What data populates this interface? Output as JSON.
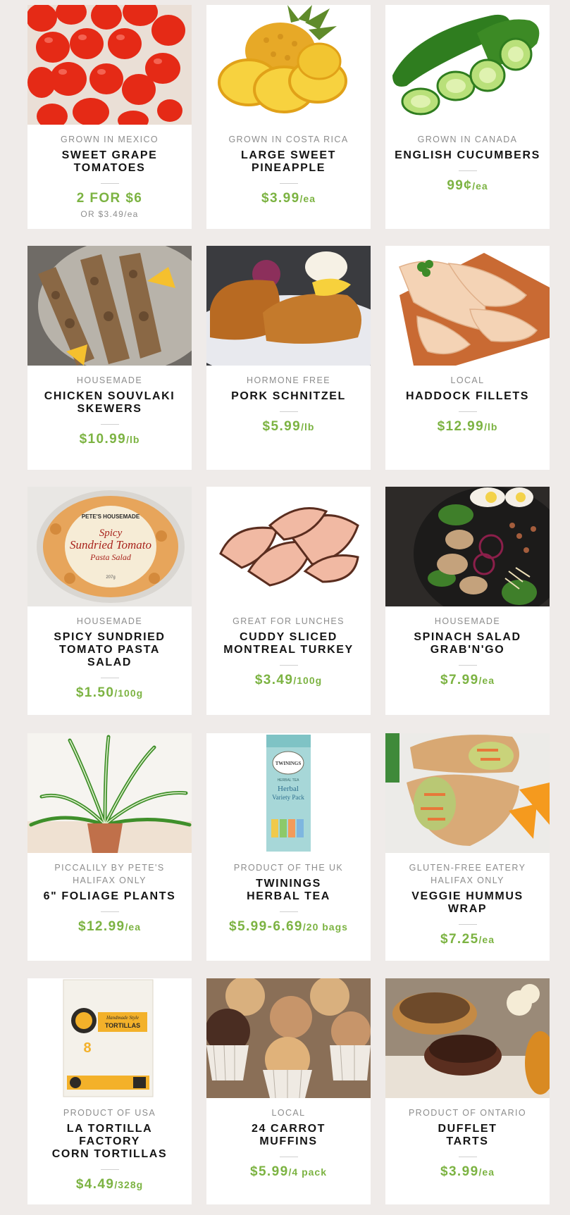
{
  "products": [
    {
      "origin_lines": [
        "Grown in Mexico"
      ],
      "name": "SWEET GRAPE\nTOMATOES",
      "price": "2 FOR $6",
      "unit": "",
      "sub": "OR $3.49/ea",
      "image": "grape-tomatoes-image",
      "image_alt": "Red grape tomatoes"
    },
    {
      "origin_lines": [
        "Grown in Costa Rica"
      ],
      "name": "LARGE SWEET\nPINEAPPLE",
      "price": "$3.99",
      "unit": "/ea",
      "sub": "",
      "image": "pineapple-image",
      "image_alt": "Sliced pineapple"
    },
    {
      "origin_lines": [
        "Grown in Canada"
      ],
      "name": "ENGLISH CUCUMBERS",
      "price": "99¢",
      "unit": "/ea",
      "sub": "",
      "image": "cucumber-image",
      "image_alt": "Sliced cucumber"
    },
    {
      "origin_lines": [
        "Housemade"
      ],
      "name": "CHICKEN SOUVLAKI\nSKEWERS",
      "price": "$10.99",
      "unit": "/lb",
      "sub": "",
      "image": "souvlaki-image",
      "image_alt": "Chicken souvlaki skewers"
    },
    {
      "origin_lines": [
        "Hormone Free"
      ],
      "name": "PORK SCHNITZEL",
      "price": "$5.99",
      "unit": "/lb",
      "sub": "",
      "image": "schnitzel-image",
      "image_alt": "Pork schnitzel"
    },
    {
      "origin_lines": [
        "Local"
      ],
      "name": "HADDOCK FILLETS",
      "price": "$12.99",
      "unit": "/lb",
      "sub": "",
      "image": "haddock-image",
      "image_alt": "Haddock fillets on board"
    },
    {
      "origin_lines": [
        "Housemade"
      ],
      "name": "SPICY SUNDRIED\nTOMATO PASTA\nSALAD",
      "price": "$1.50",
      "unit": "/100g",
      "sub": "",
      "image": "pasta-salad-image",
      "image_alt": "Pasta salad container",
      "label_text": {
        "brand": "PETE'S HOUSEMADE",
        "line1": "Spicy",
        "line2": "Sundried Tomato",
        "line3": "Pasta Salad",
        "weight": "207g"
      }
    },
    {
      "origin_lines": [
        "Great for Lunches"
      ],
      "name": "CUDDY SLICED\nMONTREAL TURKEY",
      "price": "$3.49",
      "unit": "/100g",
      "sub": "",
      "image": "turkey-image",
      "image_alt": "Sliced turkey"
    },
    {
      "origin_lines": [
        "Housemade"
      ],
      "name": "SPINACH SALAD\nGRAB'N'GO",
      "price": "$7.99",
      "unit": "/ea",
      "sub": "",
      "image": "spinach-salad-image",
      "image_alt": "Spinach salad"
    },
    {
      "origin_lines": [
        "Piccalily by Pete's",
        "Halifax Only"
      ],
      "name": "6\" FOLIAGE PLANTS",
      "price": "$12.99",
      "unit": "/ea",
      "sub": "",
      "image": "plant-image",
      "image_alt": "Spider plant"
    },
    {
      "origin_lines": [
        "Product of the UK"
      ],
      "name": "TWININGS\nHERBAL TEA",
      "price": "$5.99-6.69",
      "unit": "/20 bags",
      "sub": "",
      "image": "tea-box-image",
      "image_alt": "Twinings tea box",
      "label_text": {
        "brand": "TWININGS",
        "line1": "HERBAL TEA",
        "line2": "Herbal",
        "line3": "Variety Pack"
      }
    },
    {
      "origin_lines": [
        "Gluten-Free Eatery",
        "Halifax Only"
      ],
      "name": "VEGGIE HUMMUS\nWRAP",
      "price": "$7.25",
      "unit": "/ea",
      "sub": "",
      "image": "wrap-image",
      "image_alt": "Veggie wrap"
    },
    {
      "origin_lines": [
        "Product of USA"
      ],
      "name": "LA TORTILLA\nFACTORY\nCORN TORTILLAS",
      "price": "$4.49",
      "unit": "/328g",
      "sub": "",
      "image": "tortillas-image",
      "image_alt": "Tortilla package",
      "label_text": {
        "line1": "Handmade Style",
        "line2": "TORTILLAS",
        "count": "8"
      }
    },
    {
      "origin_lines": [
        "Local"
      ],
      "name": "24 CARROT\nMUFFINS",
      "price": "$5.99",
      "unit": "/4 pack",
      "sub": "",
      "image": "muffins-image",
      "image_alt": "Muffins"
    },
    {
      "origin_lines": [
        "Product of Ontario"
      ],
      "name": "DUFFLET\nTARTS",
      "price": "$3.99",
      "unit": "/ea",
      "sub": "",
      "image": "tarts-image",
      "image_alt": "Tarts"
    }
  ],
  "colors": {
    "background": "#efebe9",
    "card": "#ffffff",
    "price": "#7cb342",
    "origin": "#8d8d8d",
    "name": "#141414"
  }
}
